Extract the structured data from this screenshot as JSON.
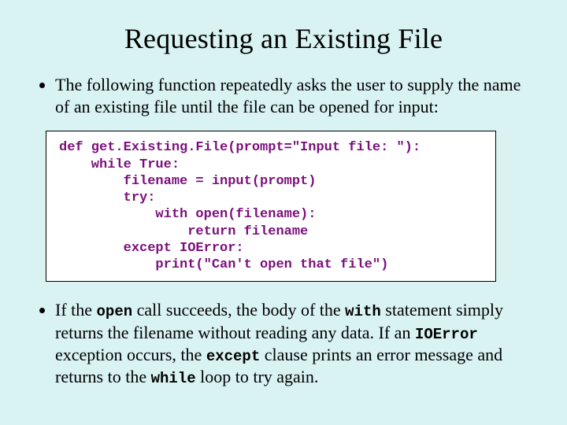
{
  "title": "Requesting an Existing File",
  "bullet1": "The following function repeatedly asks the user to supply the name of an existing file until the file can be opened for input:",
  "code": "def get.Existing.File(prompt=\"Input file: \"):\n    while True:\n        filename = input(prompt)\n        try:\n            with open(filename):\n                return filename\n        except IOError:\n            print(\"Can't open that file\")",
  "b2": {
    "t1": "If the ",
    "c1": "open",
    "t2": " call succeeds, the body of the ",
    "c2": "with",
    "t3": " statement simply returns the filename without reading any data.  If an ",
    "c3": "IOError",
    "t4": " exception occurs, the ",
    "c4": "except",
    "t5": " clause prints an error message and returns to the ",
    "c5": "while",
    "t6": " loop to try again."
  }
}
